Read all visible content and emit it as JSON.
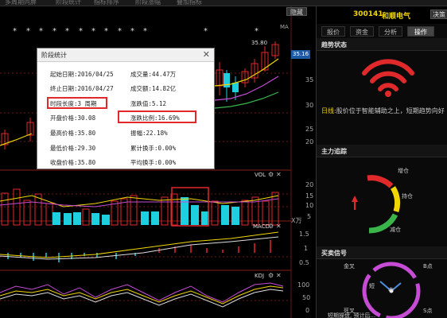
{
  "menubar": [
    "多周期同屏",
    "阶段统计",
    "指标排序",
    "阶段涨幅",
    "叠加指标"
  ],
  "chart": {
    "hide_btn": "隐藏",
    "ma_label": "MA",
    "price_high": "35.80",
    "price_tag": "35.16",
    "y_main": [
      "35",
      "30",
      "25",
      "20"
    ],
    "vol_label": "VOL",
    "vol_y": [
      "20",
      "15",
      "10",
      "5"
    ],
    "vol_unit": "X万",
    "macd_label": "MACD",
    "macd_y": [
      "1.5",
      "1",
      "0.5"
    ],
    "kdj_label": "KDJ",
    "kdj_y": [
      "100",
      "50",
      "0"
    ]
  },
  "right": {
    "code": "300141",
    "name": "和顺电气",
    "decision_btn": "决策",
    "tabs": [
      "报价",
      "资金",
      "分析",
      "操作"
    ],
    "active_tab": "操作",
    "trend_title": "趋势状态",
    "trend_label": "日线:",
    "trend_text": "股价位于智能辅助之上，短期趋势向好",
    "force_title": "主力追踪",
    "force_labels": [
      "增仓",
      "持仓",
      "减仓"
    ],
    "signal_title": "买卖信号",
    "signal_labels": [
      "金叉",
      "B点",
      "死叉",
      "S点",
      "短",
      "中"
    ],
    "bottom_text": "短期操盘, 预计后..."
  },
  "dialog": {
    "title": "阶段统计",
    "close": "✕",
    "rows": [
      [
        "起始日期:2016/04/25",
        "成交量:44.47万"
      ],
      [
        "终止日期:2016/04/27",
        "成交额:14.82亿"
      ],
      [
        "时段长度:3 周期",
        "涨跌值:5.12"
      ],
      [
        "开盘价格:30.08",
        "涨跌比例:16.69%"
      ],
      [
        "最高价格:35.80",
        "振幅:22.18%"
      ],
      [
        "最低价格:29.30",
        "累计换手:0.00%"
      ],
      [
        "收盘价格:35.80",
        "平均换手:0.00%"
      ]
    ]
  },
  "colors": {
    "accent_red": "#e0292b",
    "up": "#e0292b",
    "down": "#1ecfe0",
    "yellow": "#f2d600",
    "green": "#3ab54a"
  }
}
